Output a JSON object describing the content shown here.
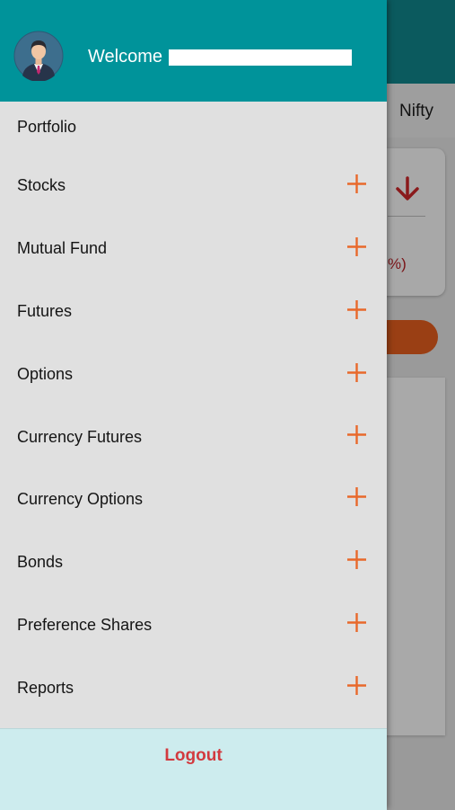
{
  "background": {
    "tab_label": "Nifty",
    "card_value_fragment": "%)"
  },
  "drawer": {
    "welcome_text": "Welcome :",
    "user_name": "",
    "menu_items": [
      {
        "label": "Portfolio",
        "expandable": false
      },
      {
        "label": "Stocks",
        "expandable": true
      },
      {
        "label": "Mutual Fund",
        "expandable": true
      },
      {
        "label": "Futures",
        "expandable": true
      },
      {
        "label": "Options",
        "expandable": true
      },
      {
        "label": "Currency Futures",
        "expandable": true
      },
      {
        "label": "Currency Options",
        "expandable": true
      },
      {
        "label": "Bonds",
        "expandable": true
      },
      {
        "label": "Preference Shares",
        "expandable": true
      },
      {
        "label": "Reports",
        "expandable": true
      }
    ],
    "logout_label": "Logout"
  },
  "colors": {
    "drawer_header": "#00939a",
    "accent_plus": "#e8692b",
    "logout_text": "#d23a3f",
    "logout_bg": "#cdecee"
  },
  "icons": {
    "avatar": "user-avatar-icon",
    "expand": "plus-icon",
    "trend": "arrow-down-icon"
  }
}
